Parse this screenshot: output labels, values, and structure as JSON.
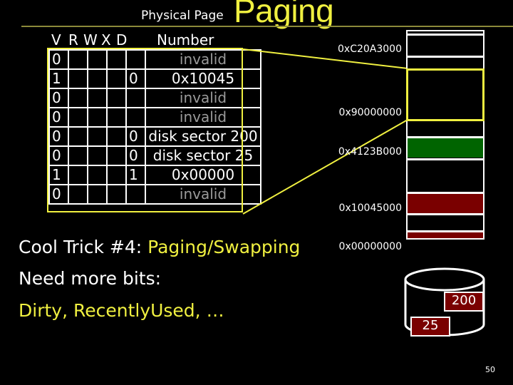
{
  "slide": {
    "title": "Paging",
    "number": "50"
  },
  "page_table": {
    "header_ppn_line1": "Physical Page",
    "header_ppn_line2": "Number",
    "columns": [
      "V",
      "R",
      "W",
      "X",
      "D"
    ],
    "rows": [
      {
        "V": "0",
        "R": "",
        "W": "",
        "X": "",
        "D": "",
        "ppn": "invalid",
        "invalid": true
      },
      {
        "V": "1",
        "R": "",
        "W": "",
        "X": "",
        "D": "0",
        "ppn": "0x10045",
        "invalid": false
      },
      {
        "V": "0",
        "R": "",
        "W": "",
        "X": "",
        "D": "",
        "ppn": "invalid",
        "invalid": true
      },
      {
        "V": "0",
        "R": "",
        "W": "",
        "X": "",
        "D": "",
        "ppn": "invalid",
        "invalid": true
      },
      {
        "V": "0",
        "R": "",
        "W": "",
        "X": "",
        "D": "0",
        "ppn": "disk sector 200",
        "invalid": false
      },
      {
        "V": "0",
        "R": "",
        "W": "",
        "X": "",
        "D": "0",
        "ppn": "disk sector 25",
        "invalid": false
      },
      {
        "V": "1",
        "R": "",
        "W": "",
        "X": "",
        "D": "1",
        "ppn": "0x00000",
        "invalid": false
      },
      {
        "V": "0",
        "R": "",
        "W": "",
        "X": "",
        "D": "",
        "ppn": "invalid",
        "invalid": true
      }
    ]
  },
  "memory": {
    "addresses": [
      "0xC20A3000",
      "0x90000000",
      "0x4123B000",
      "0x10045000",
      "0x00000000"
    ],
    "colors": {
      "green": "#006400",
      "red": "#7a0000",
      "highlight": "#f0f040"
    }
  },
  "disk": {
    "sectors": [
      "200",
      "25"
    ]
  },
  "notes": {
    "line1_prefix": "Cool Trick #4: ",
    "line1_highlight": "Paging/Swapping",
    "line2": "Need more bits:",
    "line3": "Dirty, RecentlyUsed, …"
  }
}
